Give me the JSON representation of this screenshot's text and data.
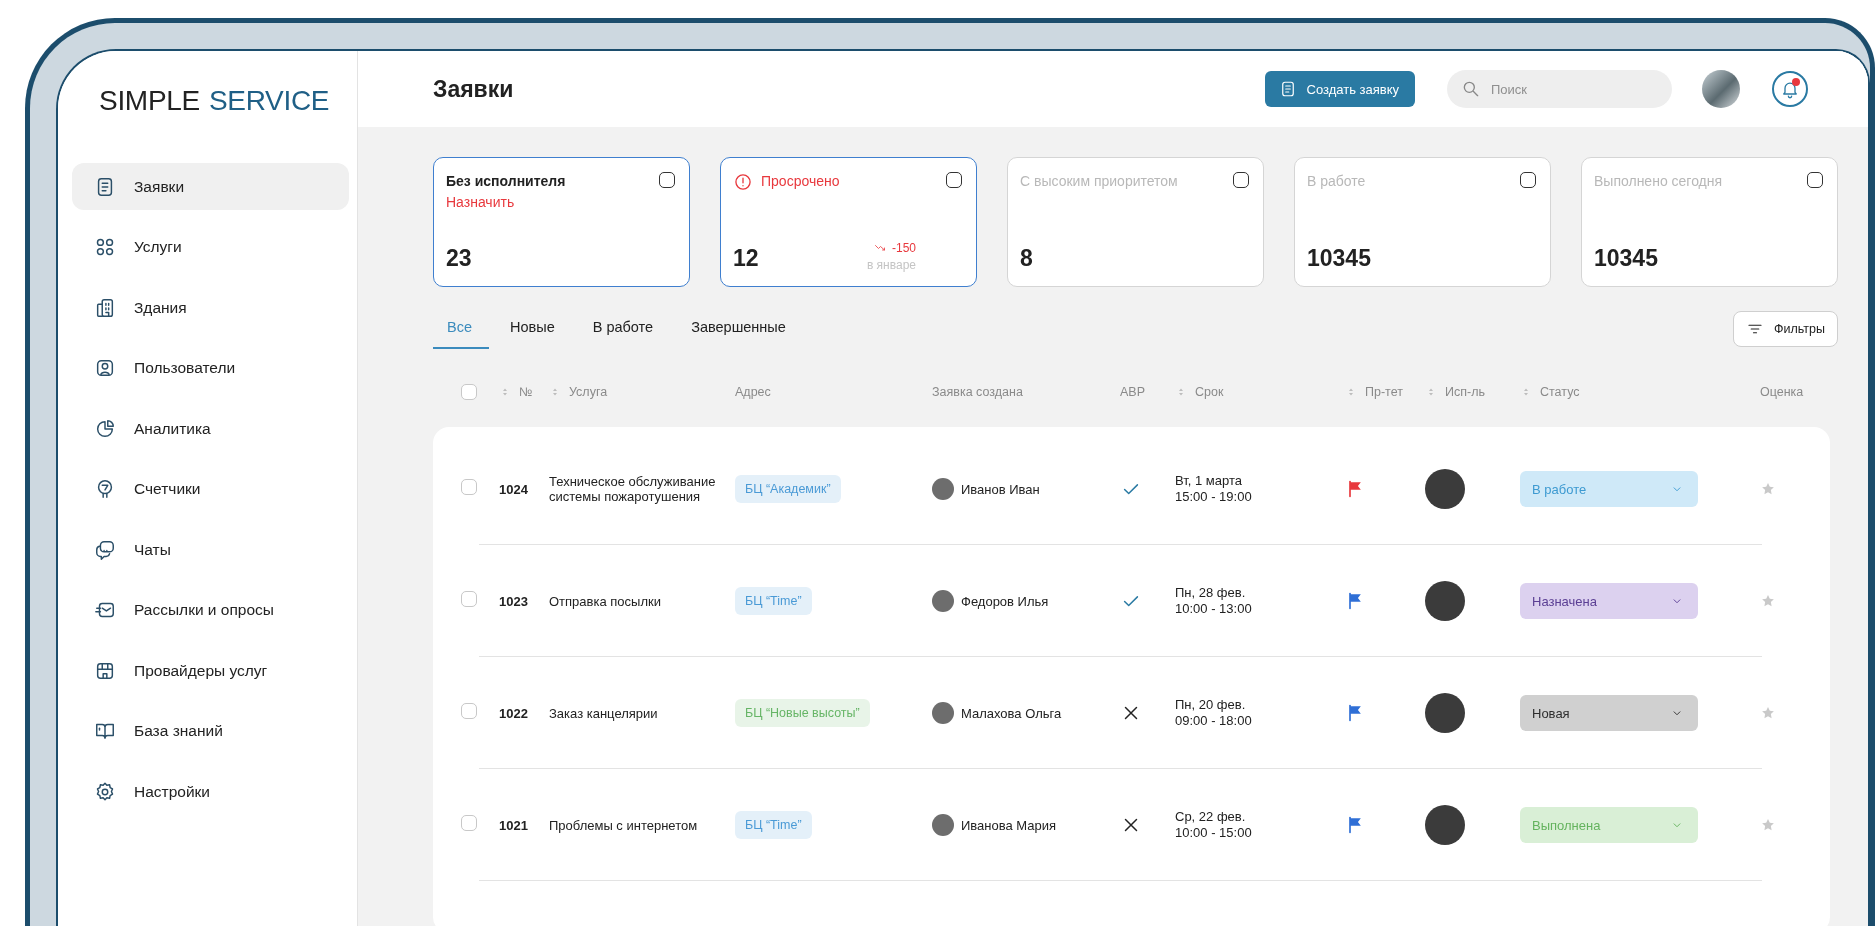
{
  "logo": {
    "part_1": "SIMPLE",
    "part_2": "SERVICE"
  },
  "sidebar": {
    "items": [
      {
        "label": "Заявки",
        "selected": true
      },
      {
        "label": "Услуги",
        "selected": false
      },
      {
        "label": "Здания",
        "selected": false
      },
      {
        "label": "Пользователи",
        "selected": false
      },
      {
        "label": "Аналитика",
        "selected": false
      },
      {
        "label": "Счетчики",
        "selected": false
      },
      {
        "label": "Чаты",
        "selected": false
      },
      {
        "label": "Рассылки и опросы",
        "selected": false
      },
      {
        "label": "Провайдеры услуг",
        "selected": false
      },
      {
        "label": "База знаний",
        "selected": false
      },
      {
        "label": "Настройки",
        "selected": false
      }
    ]
  },
  "header": {
    "title": "Заявки",
    "create_button": "Создать заявку",
    "search": {
      "placeholder": "Поиск"
    },
    "notifications_unread": true
  },
  "cards": [
    {
      "kind": "plain",
      "title": "Без исполнителя",
      "selected": true,
      "checked": false,
      "link": "Назначить",
      "value": "23"
    },
    {
      "kind": "alert",
      "title": "Просрочено",
      "selected": true,
      "checked": false,
      "value": "12",
      "trend": {
        "delta": "-150",
        "caption": "в январе"
      }
    },
    {
      "kind": "plain",
      "title": "С высоким приоритетом",
      "selected": false,
      "checked": false,
      "value": "8"
    },
    {
      "kind": "plain",
      "title": "В работе",
      "selected": false,
      "checked": false,
      "value": "10345"
    },
    {
      "kind": "plain",
      "title": "Выполнено сегодня",
      "selected": false,
      "checked": false,
      "value": "10345"
    }
  ],
  "tabs": [
    {
      "label": "Все",
      "selected": true
    },
    {
      "label": "Новые",
      "selected": false
    },
    {
      "label": "В работе",
      "selected": false
    },
    {
      "label": "Завершенные",
      "selected": false
    }
  ],
  "filters_button": "Фильтры",
  "table": {
    "select_all_checked": false,
    "columns": [
      {
        "label": "№",
        "sortable": true
      },
      {
        "label": "Услуга",
        "sortable": true
      },
      {
        "label": "Адрес",
        "sortable": false
      },
      {
        "label": "Заявка создана",
        "sortable": false
      },
      {
        "label": "АВР",
        "sortable": false
      },
      {
        "label": "Срок",
        "sortable": true
      },
      {
        "label": "Пр-тет",
        "sortable": true
      },
      {
        "label": "Исп-ль",
        "sortable": true
      },
      {
        "label": "Статус",
        "sortable": true
      },
      {
        "label": "Оценка",
        "sortable": false
      }
    ],
    "rows": [
      {
        "checked": false,
        "number": "1024",
        "service": "Техническое обслуживание системы пожаротушения",
        "address": {
          "label": "БЦ “Академик”",
          "color": "#4a9ad6"
        },
        "creator": "Иванов Иван",
        "abr": true,
        "deadline": [
          "Вт, 1 марта",
          "15:00 - 19:00"
        ],
        "priority": {
          "color": "#e8383d"
        },
        "status": {
          "label": "В работе",
          "kind": "in_progress"
        }
      },
      {
        "checked": false,
        "number": "1023",
        "service": "Отправка посылки",
        "address": {
          "label": "БЦ “Time”",
          "color": "#4a9ad6"
        },
        "creator": "Федоров Илья",
        "abr": true,
        "deadline": [
          "Пн, 28 фев.",
          "10:00 - 13:00"
        ],
        "priority": {
          "color": "#2f6fd6"
        },
        "status": {
          "label": "Назначена",
          "kind": "assigned"
        }
      },
      {
        "checked": false,
        "number": "1022",
        "service": "Заказ канцелярии",
        "address": {
          "label": "БЦ “Новые высоты”",
          "color": "#66b566"
        },
        "creator": "Малахова Ольга",
        "abr": false,
        "deadline": [
          "Пн, 20 фев.",
          "09:00 - 18:00"
        ],
        "priority": {
          "color": "#2f6fd6"
        },
        "status": {
          "label": "Новая",
          "kind": "new"
        }
      },
      {
        "checked": false,
        "number": "1021",
        "service": "Проблемы с интернетом",
        "address": {
          "label": "БЦ “Time”",
          "color": "#4a9ad6"
        },
        "creator": "Иванова Мария",
        "abr": false,
        "deadline": [
          "Ср, 22 фев.",
          "10:00 - 15:00"
        ],
        "priority": {
          "color": "#2f6fd6"
        },
        "status": {
          "label": "Выполнена",
          "kind": "done"
        }
      }
    ]
  }
}
